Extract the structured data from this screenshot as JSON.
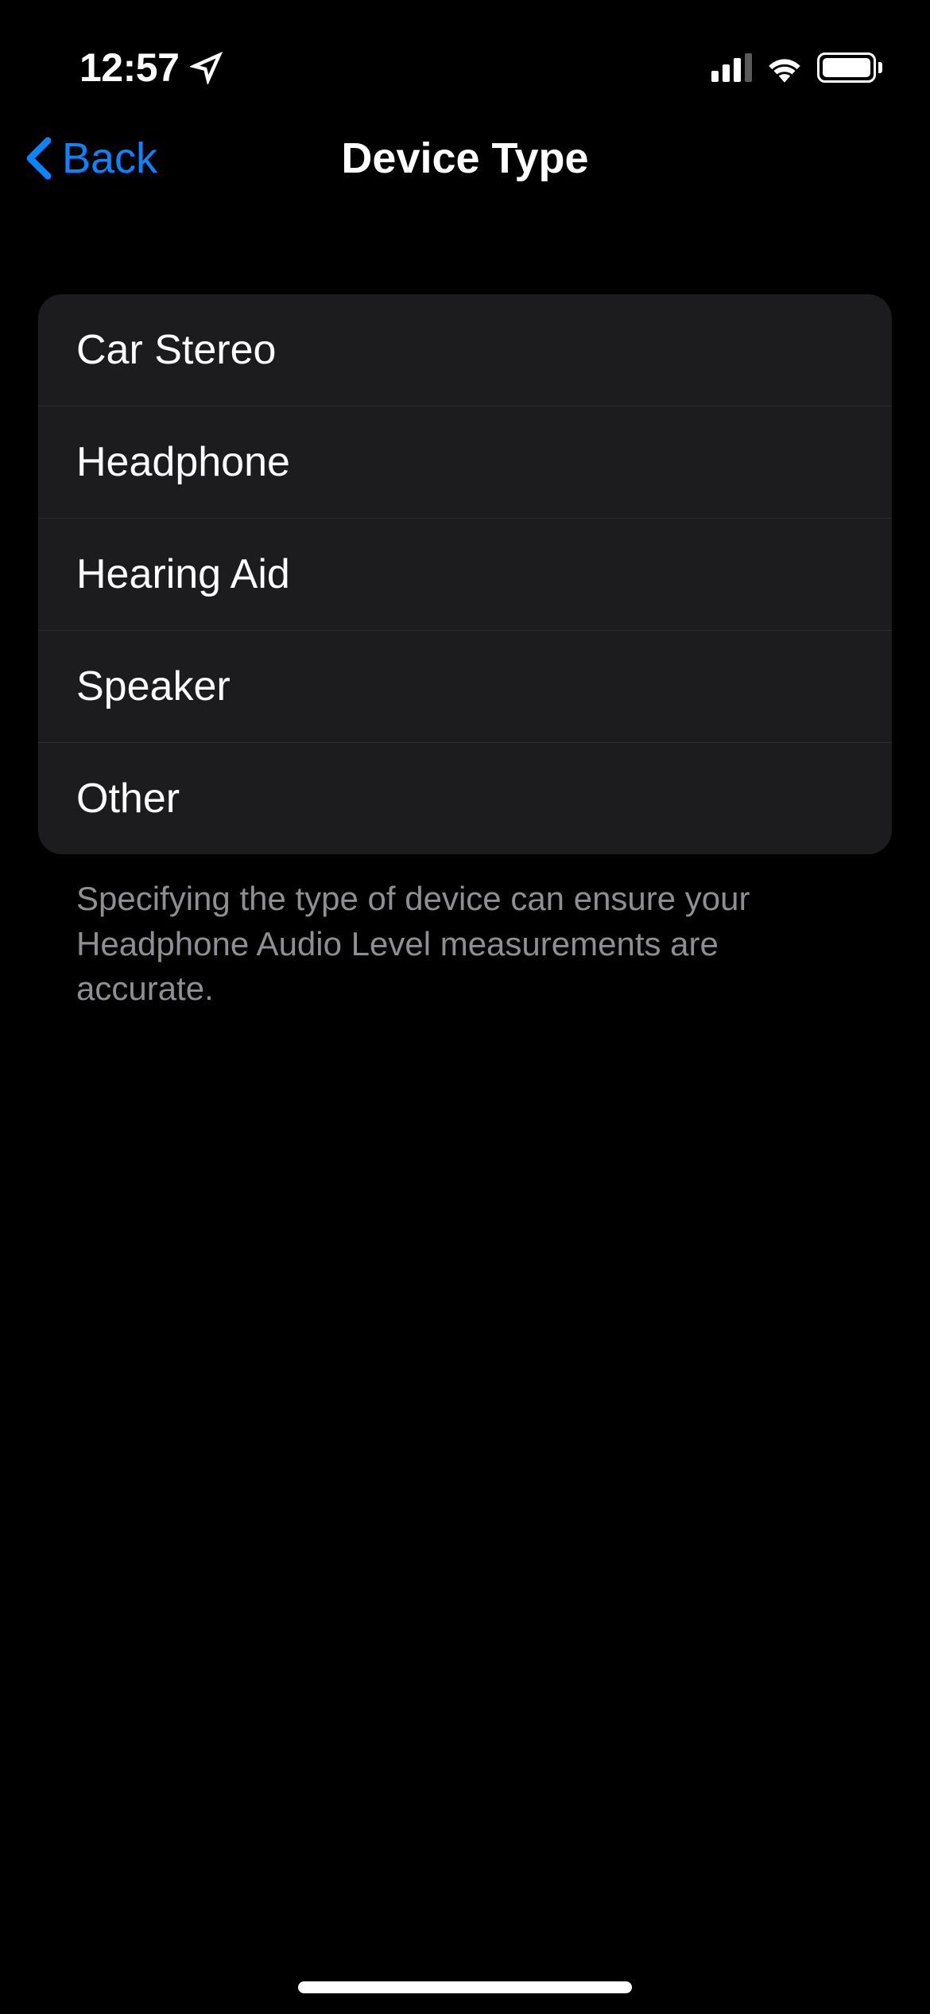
{
  "status_bar": {
    "time": "12:57"
  },
  "nav": {
    "back_label": "Back",
    "title": "Device Type"
  },
  "options": [
    {
      "label": "Car Stereo"
    },
    {
      "label": "Headphone"
    },
    {
      "label": "Hearing Aid"
    },
    {
      "label": "Speaker"
    },
    {
      "label": "Other"
    }
  ],
  "footer_text": "Specifying the type of device can ensure your Headphone Audio Level measurements are accurate."
}
